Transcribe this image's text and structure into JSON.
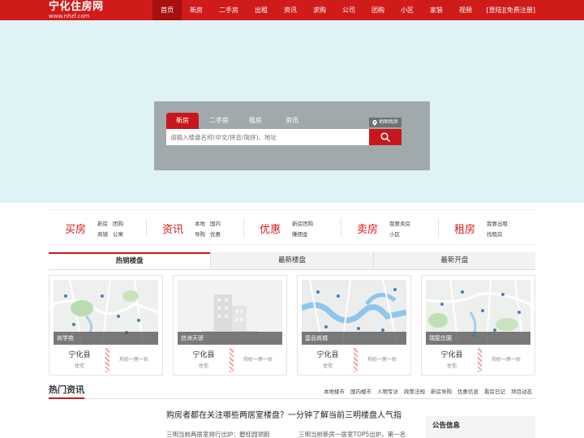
{
  "header": {
    "logo_title": "宁化住房网",
    "logo_url": "www.nhzf.com",
    "nav": [
      "首页",
      "新房",
      "二手房",
      "出租",
      "资讯",
      "求购",
      "公司",
      "团购",
      "小区",
      "家装",
      "视频"
    ],
    "login": "[登陆]",
    "register": "[免费注册]"
  },
  "search": {
    "tabs": [
      "新房",
      "二手房",
      "租房",
      "资讯"
    ],
    "map_search": "地图找房",
    "placeholder": "请输入楼盘名称(中文/拼音/简拼)、地址"
  },
  "categories": [
    {
      "title": "买房",
      "links": [
        "新房",
        "团购",
        "商铺",
        "公寓"
      ]
    },
    {
      "title": "资讯",
      "links": [
        "本地",
        "国内",
        "导购",
        "优惠"
      ]
    },
    {
      "title": "优惠",
      "links": [
        "新房团购",
        "賺佣金"
      ]
    },
    {
      "title": "卖房",
      "links": [
        "我要卖房",
        "小区"
      ]
    },
    {
      "title": "租房",
      "links": [
        "我要出租",
        "找租房"
      ]
    }
  ],
  "tabs": [
    "热销楼盘",
    "最新楼盘",
    "最新开盘"
  ],
  "cards": [
    {
      "name": "尚学苑",
      "county": "宁化县",
      "type": "住宅",
      "price": "均价一房一价"
    },
    {
      "name": "信洲天骄",
      "county": "宁化县",
      "type": "住宅",
      "price": "均价一房一价"
    },
    {
      "name": "壹品尚城",
      "county": "宁化县",
      "type": "住宅",
      "price": "均价一房一价"
    },
    {
      "name": "瑞聖庄園",
      "county": "宁化县",
      "type": "住宅",
      "price": "均价一房一价"
    }
  ],
  "news": {
    "title": "热门资讯",
    "links": [
      "本地楼市",
      "国内楼市",
      "人物专访",
      "政策法规",
      "新房导购",
      "优惠信息",
      "看房日记",
      "项目动态"
    ],
    "headline": "购房者都在关注哪些两居室楼盘？一分钟了解当前三明楼盘人气指",
    "sub_left": "三明当前两居室排行出炉：碧桂园领跑",
    "sub_right": "三明当前新房一居室TOP5出炉。第一名",
    "notice_title": "公告信息"
  }
}
